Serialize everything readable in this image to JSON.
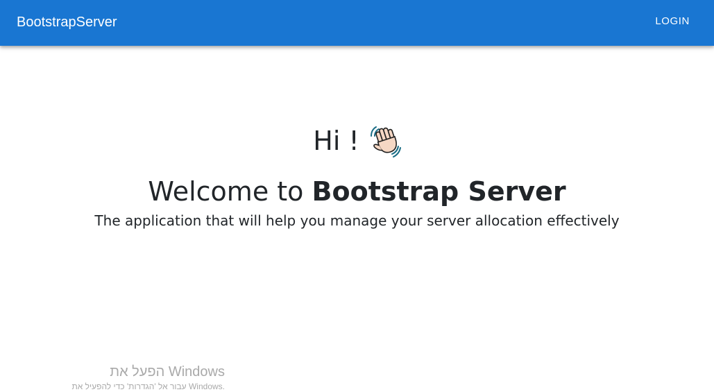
{
  "appbar": {
    "brand": "BootstrapServer",
    "login_label": "LOGIN"
  },
  "hero": {
    "greeting": "Hi !",
    "greeting_icon": "waving-hand-icon",
    "welcome_prefix": "Welcome to ",
    "welcome_bold": "Bootstrap Server",
    "tagline": "The application that will help you manage your server allocation effectively"
  },
  "watermark": {
    "title": "הפעל את Windows",
    "subtitle": "עבור אל 'הגדרות' כדי להפעיל את Windows."
  },
  "colors": {
    "appbar": "#1976d2",
    "text": "#212529",
    "watermark": "#a9a9a9"
  }
}
